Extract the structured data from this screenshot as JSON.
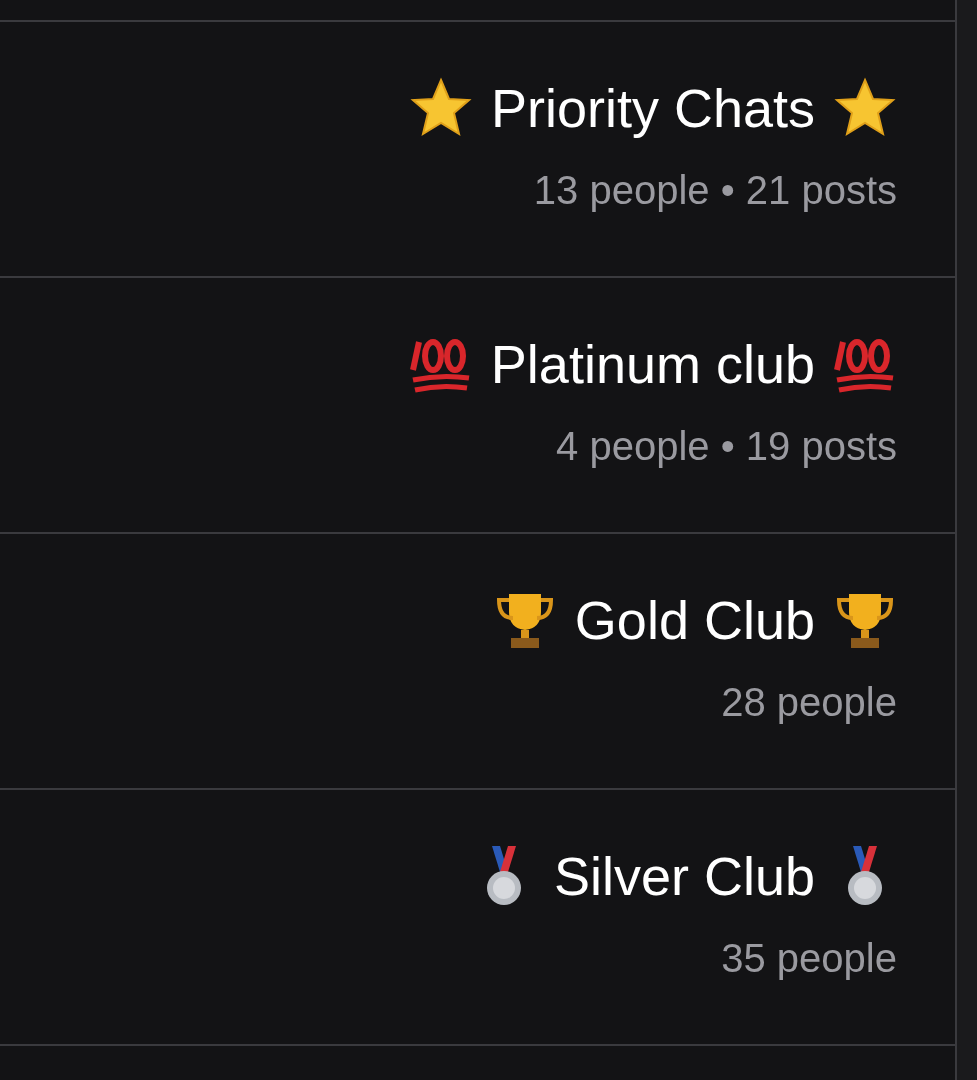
{
  "lists": [
    {
      "title": "Priority Chats",
      "kind": "star",
      "meta": "13 people • 21 posts"
    },
    {
      "title": "Platinum club",
      "kind": "hundred",
      "meta": "4 people • 19 posts"
    },
    {
      "title": "Gold Club",
      "kind": "trophy",
      "meta": "28 people"
    },
    {
      "title": "Silver Club",
      "kind": "medal",
      "meta": "35 people"
    }
  ]
}
